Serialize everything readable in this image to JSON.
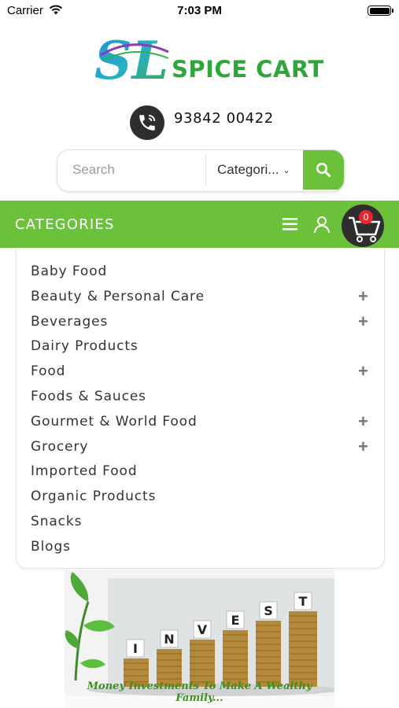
{
  "status_bar": {
    "carrier": "Carrier",
    "time": "7:03 PM"
  },
  "header": {
    "logo_text": "SPICE CART",
    "phone": "93842 00422"
  },
  "search": {
    "placeholder": "Search",
    "category_value": "Categori...",
    "button_icon": "search-icon"
  },
  "categories": {
    "title": "CATEGORIES",
    "cart_count": "0",
    "items": [
      {
        "label": "Baby Food",
        "expandable": false
      },
      {
        "label": "Beauty & Personal Care",
        "expandable": true
      },
      {
        "label": "Beverages",
        "expandable": true
      },
      {
        "label": "Dairy Products",
        "expandable": false
      },
      {
        "label": "Food",
        "expandable": true
      },
      {
        "label": "Foods & Sauces",
        "expandable": false
      },
      {
        "label": "Gourmet & World Food",
        "expandable": true
      },
      {
        "label": "Grocery",
        "expandable": true
      },
      {
        "label": "Imported Food",
        "expandable": false
      },
      {
        "label": "Organic Products",
        "expandable": false
      },
      {
        "label": "Snacks",
        "expandable": false
      },
      {
        "label": "Blogs",
        "expandable": false
      }
    ]
  },
  "banner": {
    "invest_letters": [
      "I",
      "N",
      "V",
      "E",
      "S",
      "T"
    ],
    "caption": "Money Investments To Make A Wealthy Family..."
  },
  "colors": {
    "accent_green": "#6cc13a",
    "logo_green": "#2fa63a",
    "dark": "#2e2e2e",
    "badge_red": "#e8262b"
  }
}
